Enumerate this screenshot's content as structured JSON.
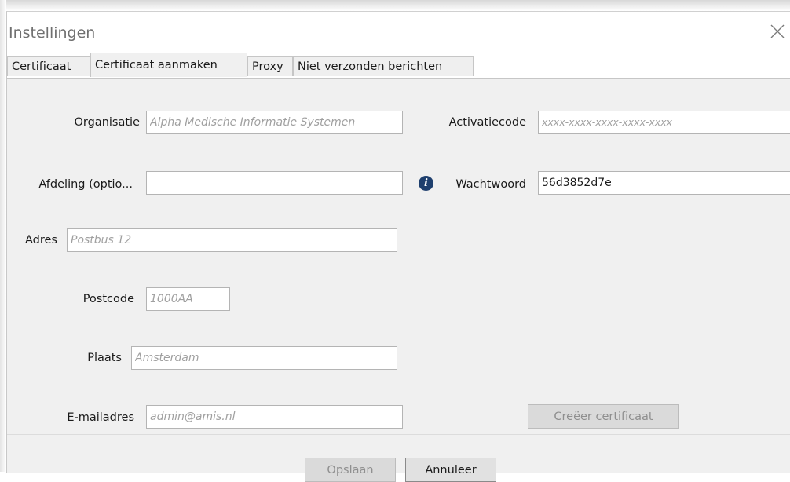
{
  "window": {
    "title": "Instellingen"
  },
  "tabs": [
    {
      "label": "Certificaat"
    },
    {
      "label": "Certificaat aanmaken",
      "active": true
    },
    {
      "label": "Proxy"
    },
    {
      "label": "Niet verzonden berichten"
    }
  ],
  "form": {
    "organisatie": {
      "label": "Organisatie",
      "value": "",
      "placeholder": "Alpha Medische Informatie Systemen"
    },
    "afdeling": {
      "label": "Afdeling (optio...",
      "value": "",
      "placeholder": ""
    },
    "adres": {
      "label": "Adres",
      "value": "",
      "placeholder": "Postbus 12"
    },
    "postcode": {
      "label": "Postcode",
      "value": "",
      "placeholder": "1000AA"
    },
    "plaats": {
      "label": "Plaats",
      "value": "",
      "placeholder": "Amsterdam"
    },
    "email": {
      "label": "E-mailadres",
      "value": "",
      "placeholder": "admin@amis.nl"
    },
    "activatiecode": {
      "label": "Activatiecode",
      "value": "",
      "placeholder": "xxxx-xxxx-xxxx-xxxx-xxxx"
    },
    "wachtwoord": {
      "label": "Wachtwoord",
      "value": "56d3852d7e",
      "placeholder": "",
      "info_icon": "info-icon"
    }
  },
  "buttons": {
    "create_certificate": {
      "label": "Creëer certificaat",
      "enabled": false
    },
    "save": {
      "label": "Opslaan",
      "enabled": false
    },
    "cancel": {
      "label": "Annuleer",
      "enabled": true
    }
  }
}
